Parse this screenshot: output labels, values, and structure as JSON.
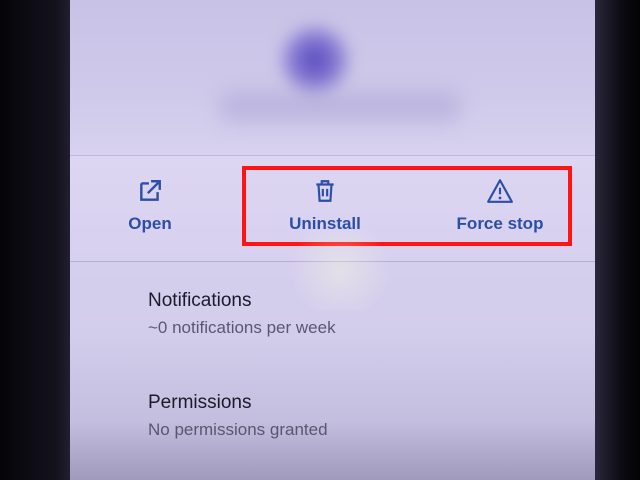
{
  "actions": {
    "open_label": "Open",
    "uninstall_label": "Uninstall",
    "force_stop_label": "Force stop"
  },
  "settings": {
    "notifications": {
      "title": "Notifications",
      "subtitle": "~0 notifications per week"
    },
    "permissions": {
      "title": "Permissions",
      "subtitle": "No permissions granted"
    }
  },
  "colors": {
    "accent": "#2d4ea8",
    "highlight": "#ff1414",
    "screen_bg": "#d7d1f0"
  },
  "icons": {
    "open": "open-in-new-icon",
    "uninstall": "trash-icon",
    "force_stop": "warning-triangle-icon"
  }
}
